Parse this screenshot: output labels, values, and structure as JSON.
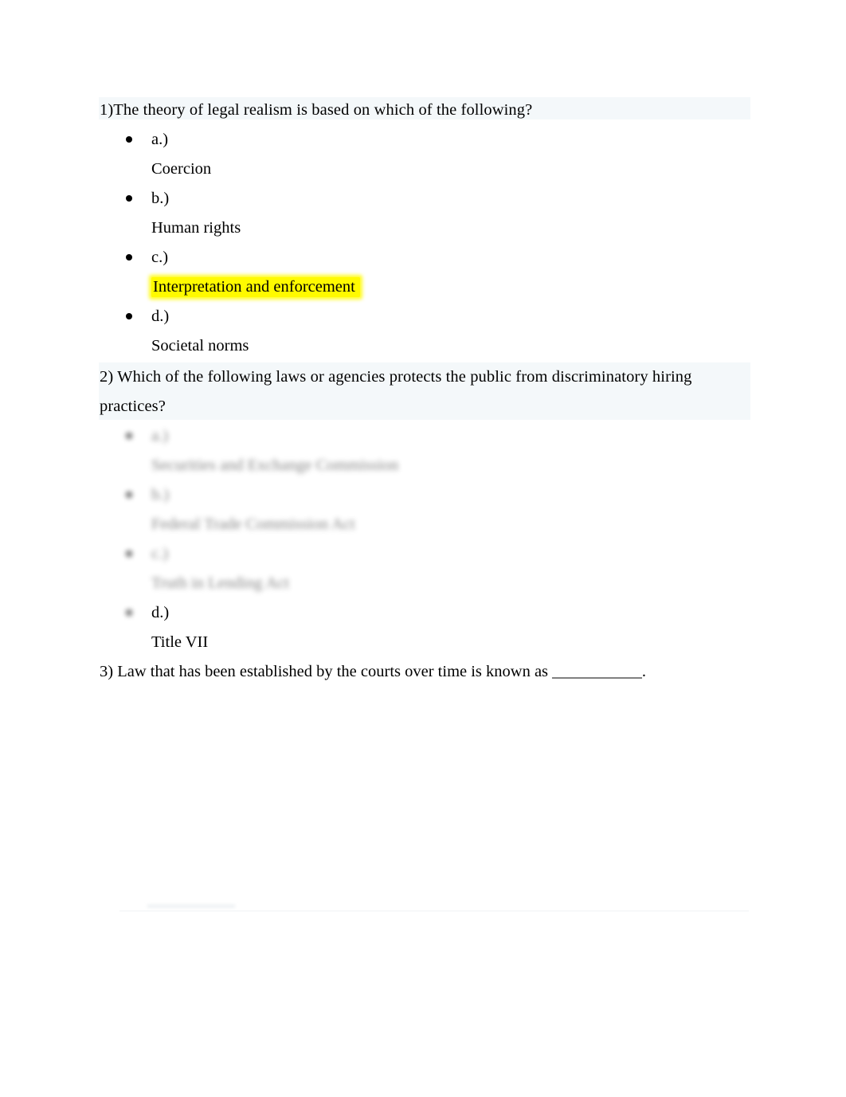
{
  "document": {
    "questions": [
      {
        "number": "1)",
        "prompt": "1)The theory of legal realism is based on which of the following?",
        "options": [
          {
            "letter": "a.)",
            "value": "Coercion",
            "highlighted": false,
            "blurred": false
          },
          {
            "letter": "b.)",
            "value": "Human rights",
            "highlighted": false,
            "blurred": false
          },
          {
            "letter": "c.)",
            "value": "Interpretation and enforcement",
            "highlighted": true,
            "blurred": false
          },
          {
            "letter": "d.)",
            "value": "Societal norms",
            "highlighted": false,
            "blurred": false
          }
        ]
      },
      {
        "number": "2)",
        "prompt": "2) Which of the following laws or agencies protects the public from discriminatory hiring practices?",
        "options": [
          {
            "letter": "a.)",
            "value": "Securities and Exchange Commission",
            "highlighted": false,
            "blurred": true
          },
          {
            "letter": "b.)",
            "value": "Federal Trade Commission Act",
            "highlighted": false,
            "blurred": true
          },
          {
            "letter": "c.)",
            "value": "Truth in Lending Act",
            "highlighted": false,
            "blurred": true
          },
          {
            "letter": "d.)",
            "value": "Title VII",
            "highlighted": false,
            "blurred": false
          }
        ]
      },
      {
        "number": "3)",
        "prompt": "3) Law that has been established by the courts over time is known as ___________.",
        "options": []
      }
    ]
  },
  "colors": {
    "highlight": "#fffa00",
    "band": "#f4f8fa",
    "text": "#000000"
  }
}
